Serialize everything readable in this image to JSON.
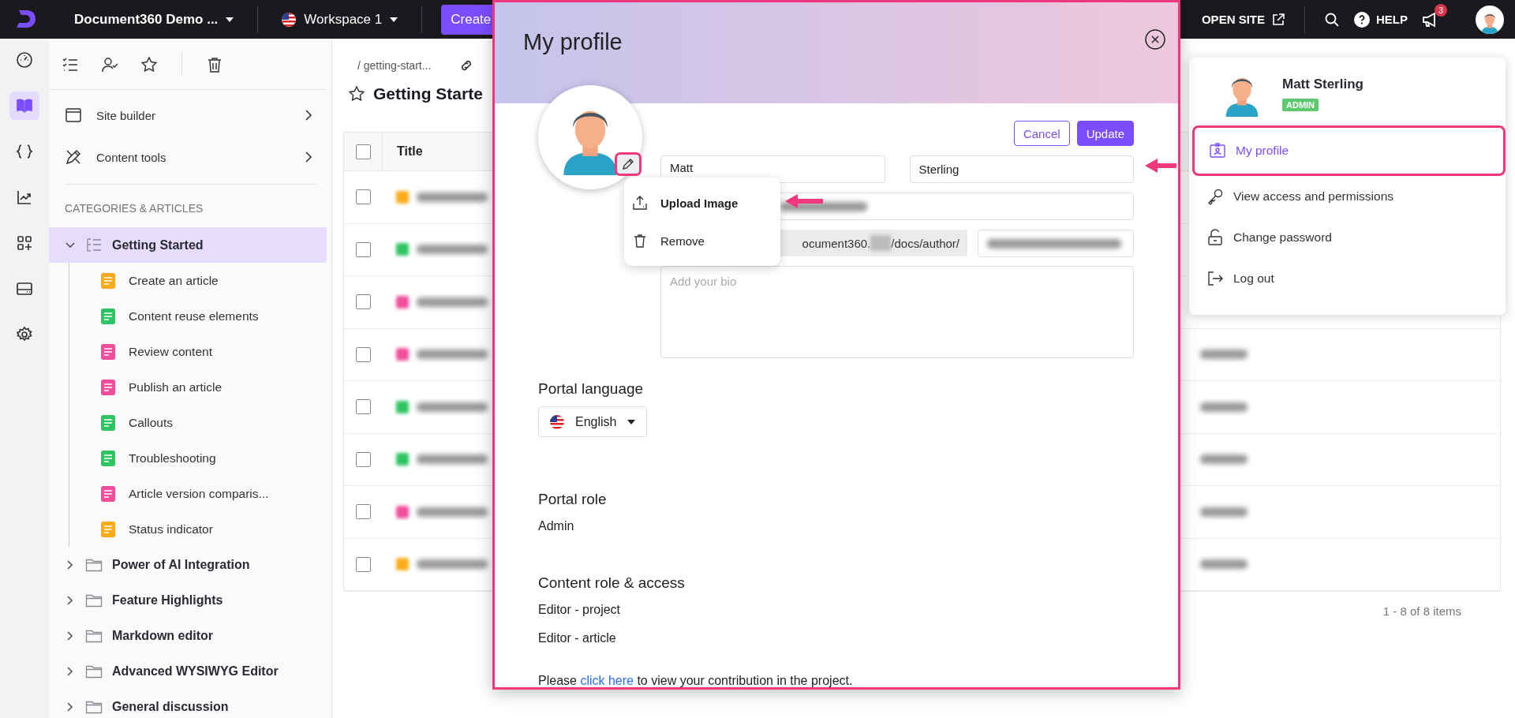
{
  "top_bar": {
    "project": "Document360 Demo ...",
    "workspace": "Workspace 1",
    "create": "Create",
    "open_site": "OPEN SITE",
    "help": "HELP",
    "notifications": "3"
  },
  "rail": [
    {
      "kind": "dashboard",
      "selected": false
    },
    {
      "kind": "docs",
      "selected": true
    },
    {
      "kind": "api",
      "selected": false
    },
    {
      "kind": "analytics",
      "selected": false
    },
    {
      "kind": "apps",
      "selected": false
    },
    {
      "kind": "drive",
      "selected": false
    },
    {
      "kind": "settings",
      "selected": false
    }
  ],
  "sidebar": {
    "tools": [
      {
        "kind": "checklist"
      },
      {
        "kind": "assigned"
      },
      {
        "kind": "star"
      },
      {
        "kind": "trash"
      }
    ],
    "menu": [
      {
        "label": "Site builder",
        "kind": "site"
      },
      {
        "label": "Content tools",
        "kind": "tools"
      }
    ],
    "section_title": "CATEGORIES & ARTICLES",
    "tree": [
      {
        "label": "Getting Started",
        "kind": "category",
        "expanded": true,
        "selected": true,
        "children": [
          {
            "label": "Create an article",
            "color": "#fbab18"
          },
          {
            "label": "Content reuse elements",
            "color": "#2ec461"
          },
          {
            "label": "Review content",
            "color": "#f04d9b"
          },
          {
            "label": "Publish an article",
            "color": "#f04d9b"
          },
          {
            "label": "Callouts",
            "color": "#2ec461"
          },
          {
            "label": "Troubleshooting",
            "color": "#2ec461"
          },
          {
            "label": "Article version comparis...",
            "color": "#f04d9b"
          },
          {
            "label": "Status indicator",
            "color": "#fbab18"
          }
        ]
      },
      {
        "label": "Power of AI Integration",
        "kind": "folder",
        "expanded": false,
        "selected": false
      },
      {
        "label": "Feature Highlights",
        "kind": "folder",
        "expanded": false,
        "selected": false
      },
      {
        "label": "Markdown editor",
        "kind": "folder",
        "expanded": false,
        "selected": false
      },
      {
        "label": "Advanced WYSIWYG Editor",
        "kind": "folder",
        "expanded": false,
        "selected": false
      },
      {
        "label": "General discussion",
        "kind": "folder",
        "expanded": false,
        "selected": false
      }
    ]
  },
  "main": {
    "breadcrumb": "/ getting-start...",
    "title": "Getting Starte",
    "table": {
      "columns": [
        "Title"
      ],
      "select_all_checked": false,
      "rows": [
        {
          "checked": false,
          "color": "#fbab18"
        },
        {
          "checked": false,
          "color": "#2ec461"
        },
        {
          "checked": false,
          "color": "#f04d9b"
        },
        {
          "checked": false,
          "color": "#f04d9b"
        },
        {
          "checked": false,
          "color": "#2ec461"
        },
        {
          "checked": false,
          "color": "#2ec461"
        },
        {
          "checked": false,
          "color": "#f04d9b"
        },
        {
          "checked": false,
          "color": "#fbab18"
        }
      ]
    },
    "pagination": "1 - 8 of 8 items"
  },
  "modal": {
    "title": "My profile",
    "buttons": [
      {
        "label": "Cancel",
        "kind": "secondary"
      },
      {
        "label": "Update",
        "kind": "primary"
      }
    ],
    "first_name": "Matt",
    "last_name": "Sterling",
    "url_prefix_start": "ocument360.",
    "url_prefix_end": "/docs/author/",
    "bio_placeholder": "Add your bio",
    "avatar_menu": [
      {
        "label": "Upload Image",
        "kind": "upload"
      },
      {
        "label": "Remove",
        "kind": "remove"
      }
    ],
    "language": {
      "heading": "Portal language",
      "value": "English"
    },
    "sections": [
      {
        "heading": "Portal role",
        "lines": [
          "Admin"
        ]
      },
      {
        "heading": "Content role & access",
        "lines": [
          "Editor - project",
          "Editor - article"
        ]
      }
    ],
    "note": {
      "before": "Please ",
      "link": "click here",
      "after": " to view your contribution in the project."
    }
  },
  "profile_menu": {
    "name": "Matt Sterling",
    "role": "ADMIN",
    "items": [
      {
        "label": "My profile",
        "kind": "profile",
        "selected": true
      },
      {
        "label": "View access and permissions",
        "kind": "key",
        "selected": false
      },
      {
        "label": "Change password",
        "kind": "lock",
        "selected": false
      },
      {
        "label": "Log out",
        "kind": "logout",
        "selected": false
      }
    ]
  }
}
